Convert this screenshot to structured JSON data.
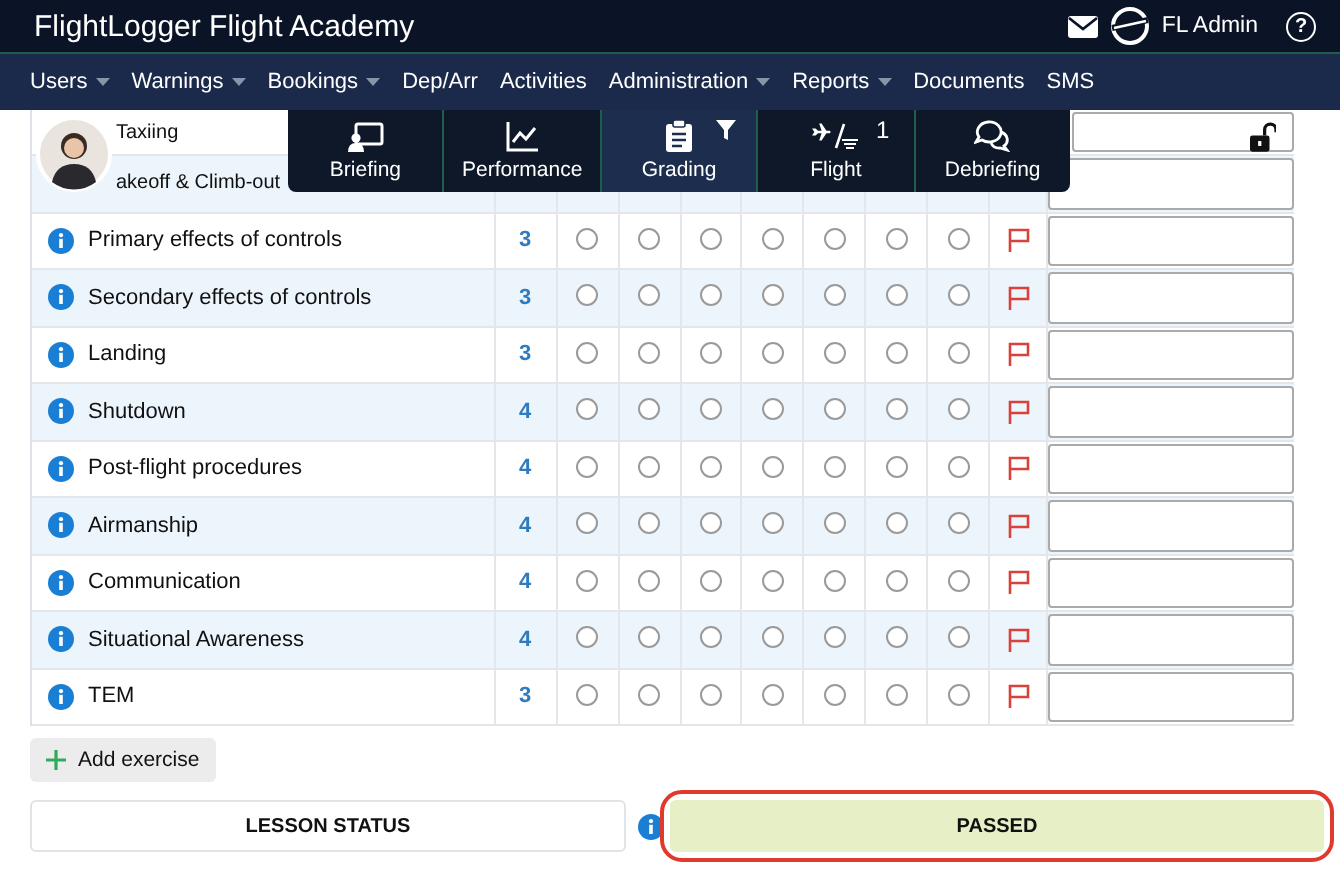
{
  "header": {
    "title": "FlightLogger Flight Academy",
    "user": "FL Admin",
    "help": "?"
  },
  "nav": [
    {
      "label": "Users",
      "dropdown": true
    },
    {
      "label": "Warnings",
      "dropdown": true
    },
    {
      "label": "Bookings",
      "dropdown": true
    },
    {
      "label": "Dep/Arr",
      "dropdown": false
    },
    {
      "label": "Activities",
      "dropdown": false
    },
    {
      "label": "Administration",
      "dropdown": true
    },
    {
      "label": "Reports",
      "dropdown": true
    },
    {
      "label": "Documents",
      "dropdown": false
    },
    {
      "label": "SMS",
      "dropdown": false
    }
  ],
  "tabs": [
    {
      "label": "Briefing",
      "selected": false
    },
    {
      "label": "Performance",
      "selected": false
    },
    {
      "label": "Grading",
      "selected": true,
      "filter": true
    },
    {
      "label": "Flight",
      "selected": false,
      "badge": "1"
    },
    {
      "label": "Debriefing",
      "selected": false
    }
  ],
  "exercises": [
    {
      "kind": "partial",
      "name": "Taxiing"
    },
    {
      "kind": "partial",
      "name": "akeoff & Climb-out"
    },
    {
      "kind": "full",
      "name": "Primary effects of controls",
      "level": "3",
      "grades": [
        {
          "selected": false
        },
        {
          "selected": false
        },
        {
          "selected": false
        },
        {
          "selected": false
        },
        {
          "selected": false
        },
        {
          "selected": false
        },
        {
          "selected": false
        }
      ]
    },
    {
      "kind": "full",
      "name": "Secondary effects of controls",
      "level": "3",
      "grades": [
        {
          "selected": false
        },
        {
          "selected": false
        },
        {
          "selected": false
        },
        {
          "selected": false
        },
        {
          "selected": false
        },
        {
          "selected": false
        },
        {
          "selected": false
        }
      ]
    },
    {
      "kind": "full",
      "name": "Landing",
      "level": "3",
      "grades": [
        {
          "selected": false
        },
        {
          "selected": false
        },
        {
          "selected": false
        },
        {
          "selected": false
        },
        {
          "selected": false
        },
        {
          "selected": false
        },
        {
          "selected": false
        }
      ]
    },
    {
      "kind": "full",
      "name": "Shutdown",
      "level": "4",
      "grades": [
        {
          "selected": false
        },
        {
          "selected": false
        },
        {
          "selected": false
        },
        {
          "selected": false
        },
        {
          "selected": false
        },
        {
          "selected": false
        },
        {
          "selected": false
        }
      ]
    },
    {
      "kind": "full",
      "name": "Post-flight procedures",
      "level": "4",
      "grades": [
        {
          "selected": false
        },
        {
          "selected": false
        },
        {
          "selected": false
        },
        {
          "selected": false
        },
        {
          "selected": false
        },
        {
          "selected": false
        },
        {
          "selected": false
        }
      ]
    },
    {
      "kind": "full",
      "name": "Airmanship",
      "level": "4",
      "grades": [
        {
          "selected": false
        },
        {
          "selected": false
        },
        {
          "selected": false
        },
        {
          "selected": false
        },
        {
          "selected": false
        },
        {
          "selected": false
        },
        {
          "selected": false
        }
      ]
    },
    {
      "kind": "full",
      "name": "Communication",
      "level": "4",
      "grades": [
        {
          "selected": false
        },
        {
          "selected": false
        },
        {
          "selected": false
        },
        {
          "selected": false
        },
        {
          "selected": false
        },
        {
          "selected": false
        },
        {
          "selected": false
        }
      ]
    },
    {
      "kind": "full",
      "name": "Situational Awareness",
      "level": "4",
      "grades": [
        {
          "selected": false
        },
        {
          "selected": false
        },
        {
          "selected": false
        },
        {
          "selected": false
        },
        {
          "selected": false
        },
        {
          "selected": false
        },
        {
          "selected": false
        }
      ]
    },
    {
      "kind": "full",
      "name": "TEM",
      "level": "3",
      "grades": [
        {
          "selected": false
        },
        {
          "selected": false
        },
        {
          "selected": false
        },
        {
          "selected": false
        },
        {
          "selected": false
        },
        {
          "selected": false
        },
        {
          "selected": false
        }
      ]
    }
  ],
  "add_button": "Add exercise",
  "lesson_status": {
    "label": "LESSON STATUS",
    "value": "PASSED",
    "highlighted": true
  }
}
